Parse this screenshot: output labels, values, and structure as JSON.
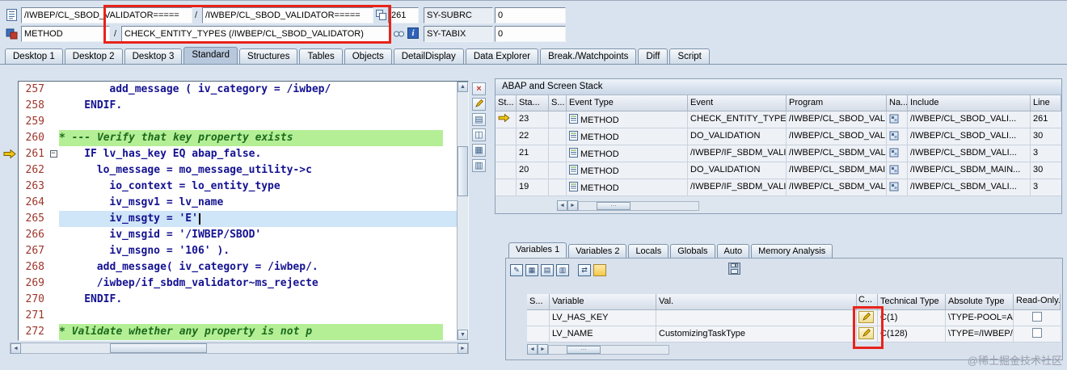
{
  "header": {
    "program_field": "/IWBEP/CL_SBOD_VALIDATOR=====",
    "separator1": "/",
    "include_field": "/IWBEP/CL_SBOD_VALIDATOR=====",
    "line_field": "261",
    "sy_subrc_label": "SY-SUBRC",
    "sy_subrc_value": "0",
    "event_field": "METHOD",
    "separator2": "/",
    "event_detail_field": "CHECK_ENTITY_TYPES (/IWBEP/CL_SBOD_VALIDATOR)",
    "sy_tabix_label": "SY-TABIX",
    "sy_tabix_value": "0"
  },
  "desktop_tabs": {
    "items": [
      "Desktop 1",
      "Desktop 2",
      "Desktop 3",
      "Standard",
      "Structures",
      "Tables",
      "Objects",
      "DetailDisplay",
      "Data Explorer",
      "Break./Watchpoints",
      "Diff",
      "Script"
    ],
    "active": "Standard"
  },
  "editor": {
    "lines": [
      {
        "n": "257",
        "text": "add_message ( iv_category = /iwbep/",
        "type": "code",
        "indent": 8
      },
      {
        "n": "258",
        "text": "ENDIF.",
        "type": "code",
        "indent": 4
      },
      {
        "n": "259",
        "text": "",
        "type": "code",
        "indent": 0
      },
      {
        "n": "260",
        "text": "* --- Verify that key property exists",
        "type": "comment",
        "indent": 0
      },
      {
        "n": "261",
        "text": "IF lv_has_key EQ abap_false.",
        "type": "code",
        "indent": 4,
        "arrow": true,
        "fold": true
      },
      {
        "n": "262",
        "text": "lo_message = mo_message_utility->c",
        "type": "code",
        "indent": 6
      },
      {
        "n": "263",
        "text": "io_context = lo_entity_type",
        "type": "code",
        "indent": 8
      },
      {
        "n": "264",
        "text": "iv_msgv1 = lv_name",
        "type": "code",
        "indent": 8
      },
      {
        "n": "265",
        "text": "iv_msgty = 'E'",
        "type": "code",
        "indent": 8,
        "cursor": true
      },
      {
        "n": "266",
        "text": "iv_msgid = '/IWBEP/SBOD'",
        "type": "code",
        "indent": 8
      },
      {
        "n": "267",
        "text": "iv_msgno = '106' ).",
        "type": "code",
        "indent": 8
      },
      {
        "n": "268",
        "text": "add_message( iv_category = /iwbep/.",
        "type": "code",
        "indent": 6
      },
      {
        "n": "269",
        "text": "/iwbep/if_sbdm_validator~ms_rejecte",
        "type": "code",
        "indent": 6
      },
      {
        "n": "270",
        "text": "ENDIF.",
        "type": "code",
        "indent": 4
      },
      {
        "n": "271",
        "text": "",
        "type": "code",
        "indent": 0
      },
      {
        "n": "272",
        "text": "* Validate whether any property is not p",
        "type": "comment",
        "indent": 0
      }
    ]
  },
  "stack_panel": {
    "title": "ABAP and Screen Stack",
    "columns": [
      "St...",
      "Sta...",
      "S...",
      "Event Type",
      "Event",
      "Program",
      "Na...",
      "Include",
      "Line"
    ],
    "rows": [
      {
        "active": true,
        "no": "23",
        "event_type": "METHOD",
        "event": "CHECK_ENTITY_TYPES",
        "program": "/IWBEP/CL_SBOD_VALI...",
        "include": "/IWBEP/CL_SBOD_VALI...",
        "line": "261"
      },
      {
        "active": false,
        "no": "22",
        "event_type": "METHOD",
        "event": "DO_VALIDATION",
        "program": "/IWBEP/CL_SBOD_VALI...",
        "include": "/IWBEP/CL_SBOD_VALI...",
        "line": "30"
      },
      {
        "active": false,
        "no": "21",
        "event_type": "METHOD",
        "event": "/IWBEP/IF_SBDM_VALID...",
        "program": "/IWBEP/CL_SBDM_VALI...",
        "include": "/IWBEP/CL_SBDM_VALI...",
        "line": "3"
      },
      {
        "active": false,
        "no": "20",
        "event_type": "METHOD",
        "event": "DO_VALIDATION",
        "program": "/IWBEP/CL_SBDM_MAIN...",
        "include": "/IWBEP/CL_SBDM_MAIN...",
        "line": "30"
      },
      {
        "active": false,
        "no": "19",
        "event_type": "METHOD",
        "event": "/IWBEP/IF_SBDM_VALID...",
        "program": "/IWBEP/CL_SBDM_VALI...",
        "include": "/IWBEP/CL_SBDM_VALI...",
        "line": "3"
      }
    ]
  },
  "variables_panel": {
    "tabs": [
      "Variables 1",
      "Variables 2",
      "Locals",
      "Globals",
      "Auto",
      "Memory Analysis"
    ],
    "active_tab": "Variables 1",
    "columns": [
      "S...",
      "Variable",
      "Val.",
      "C...",
      "Technical Type",
      "Absolute Type",
      "Read-Only..."
    ],
    "rows": [
      {
        "variable": "LV_HAS_KEY",
        "value": "",
        "tech_type": "C(1)",
        "abs_type": "\\TYPE-POOL=ABA...",
        "read_only": false
      },
      {
        "variable": "LV_NAME",
        "value": "CustomizingTaskType",
        "tech_type": "C(128)",
        "abs_type": "\\TYPE=/IWBEP/S...",
        "read_only": false
      }
    ]
  },
  "watermark": "@稀土掘金技术社区"
}
